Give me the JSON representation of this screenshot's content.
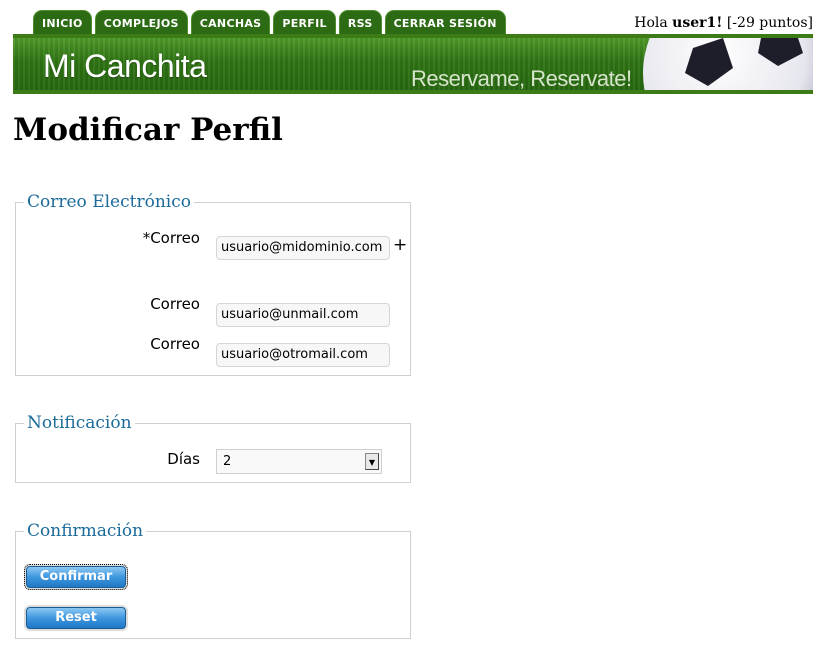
{
  "nav": {
    "tabs": [
      "INICIO",
      "COMPLEJOS",
      "CANCHAS",
      "PERFIL",
      "RSS",
      "CERRAR SESIÓN"
    ]
  },
  "greeting": {
    "prefix": "Hola ",
    "user": "user1!",
    "points": " [-29 puntos]"
  },
  "banner": {
    "title": "Mi Canchita",
    "slogan": "Reservame, Reservate!"
  },
  "page_title": "Modificar Perfil",
  "email_section": {
    "legend": "Correo Electrónico",
    "rows": [
      {
        "label": "*Correo",
        "value": "usuario@midominio.com"
      },
      {
        "label": "Correo",
        "value": "usuario@unmail.com"
      },
      {
        "label": "Correo",
        "value": "usuario@otromail.com"
      }
    ],
    "add_symbol": "+"
  },
  "notification_section": {
    "legend": "Notificación",
    "days_label": "Días",
    "days_value": "2"
  },
  "confirm_section": {
    "legend": "Confirmación",
    "confirm_label": "Confirmar",
    "reset_label": "Reset"
  },
  "colors": {
    "tab_bg": "#2d6a14",
    "banner_green": "#3a7d17",
    "legend_blue": "#1a6a9a",
    "button_blue": "#3f97de"
  }
}
